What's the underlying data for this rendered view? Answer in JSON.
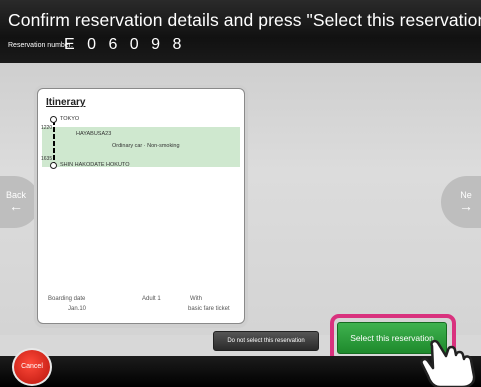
{
  "header": {
    "title": "Confirm reservation details and press \"Select this reservation\"",
    "reservation_label": "Reservation number:",
    "reservation_number": "E 0 6 0 9 8"
  },
  "nav": {
    "back_label": "Back",
    "next_label": "Ne"
  },
  "itinerary": {
    "title": "Itinerary",
    "departure_time": "1220",
    "departure_station": "TOKYO",
    "train_name": "HAYABUSA23",
    "car_info": "Ordinary car · Non-smoking",
    "arrival_time": "1635",
    "arrival_station": "SHIN HAKODATE HOKUTO",
    "boarding_date_label": "Boarding date",
    "boarding_date": "Jan.10",
    "passenger": "Adult 1",
    "fare_label": "With",
    "fare_detail": "basic fare ticket"
  },
  "actions": {
    "do_not_select_label": "Do not select this reservation",
    "select_label": "Select this reservation",
    "cancel_label": "Cancel"
  },
  "colors": {
    "accent_green": "#2a9d3a",
    "highlight_pink": "#d9327e",
    "cancel_red": "#e02418"
  }
}
